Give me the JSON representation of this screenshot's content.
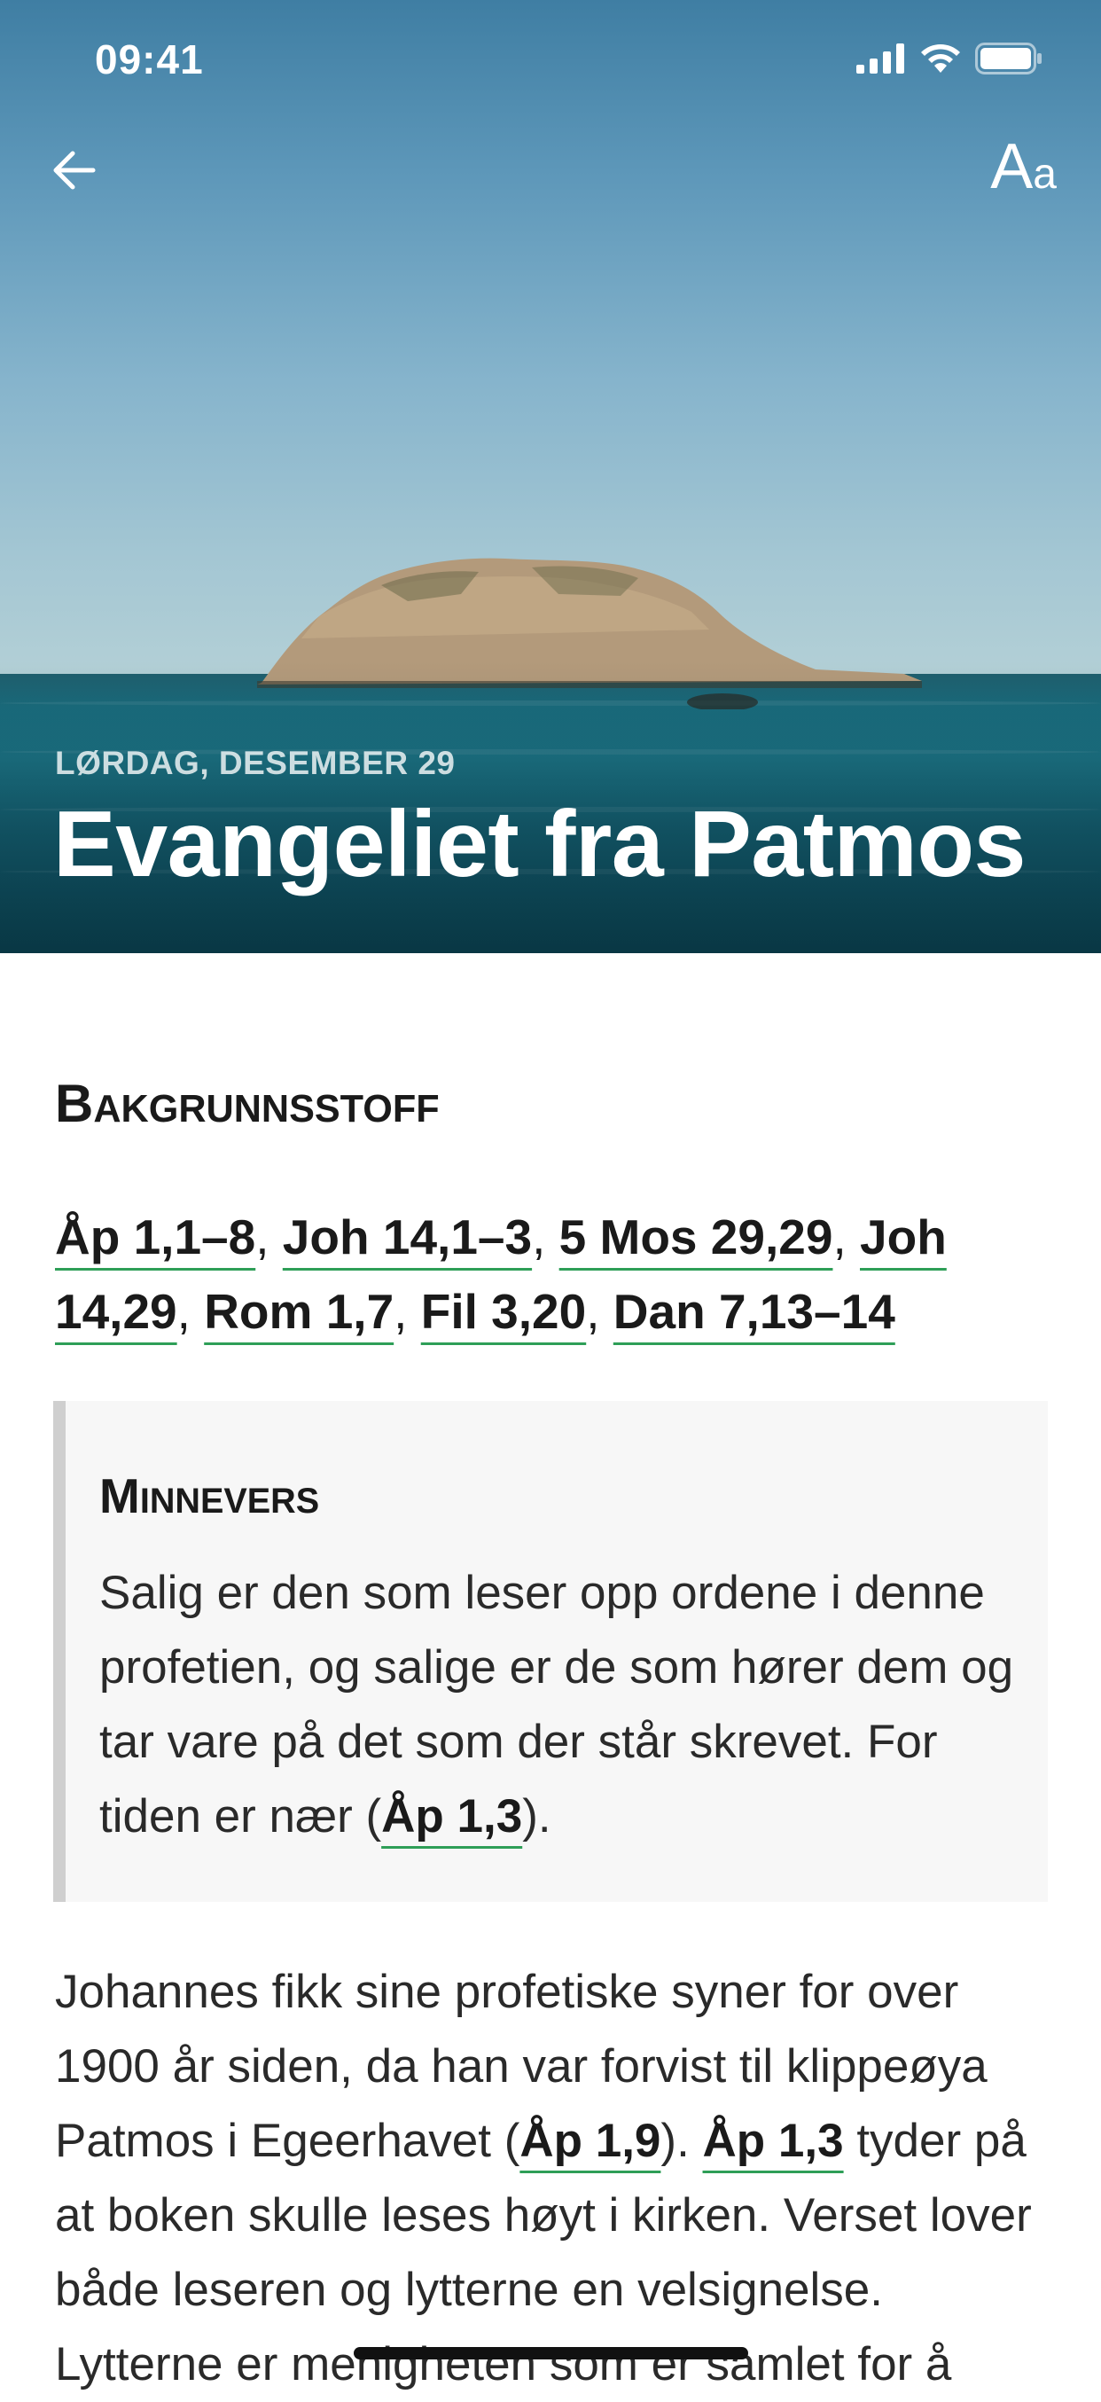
{
  "status_bar": {
    "time": "09:41"
  },
  "nav": {
    "back_icon": "arrow-left-icon",
    "font_size_icon_big": "A",
    "font_size_icon_small": "a"
  },
  "hero": {
    "date": "LØRDAG, DESEMBER 29",
    "title": "Evangeliet fra Patmos"
  },
  "section": {
    "heading_first": "B",
    "heading_rest": "AKGRUNNSSTOFF"
  },
  "references": [
    "Åp 1,1–8",
    "Joh 14,1–3",
    "5 Mos 29,29",
    "Joh 14,29",
    "Rom 1,7",
    "Fil 3,20",
    "Dan 7,13–14"
  ],
  "memory_verse": {
    "title_first": "M",
    "title_rest": "INNEVERS",
    "text": "Salig er den som leser opp ordene i denne profetien, og salige er de som hører dem og tar vare på det som der står skrevet. For tiden er nær (",
    "ref": "Åp 1,3",
    "text_end": ")."
  },
  "body": {
    "part1": "Johannes fikk sine profetiske syner for over 1900 år siden, da han var forvist til klippeøya Patmos i Egeerhavet (",
    "ref1": "Åp 1,9",
    "part2": "). ",
    "ref2": "Åp 1,3",
    "part3": " tyder på at boken skulle leses høyt i kirken. Verset lover både leseren og lytterne en velsignelse. Lytterne er menigheten som er samlet for å"
  },
  "colors": {
    "link_underline": "#2e9e57",
    "memory_bg": "#f7f7f7",
    "memory_border": "#cfcfcf"
  }
}
